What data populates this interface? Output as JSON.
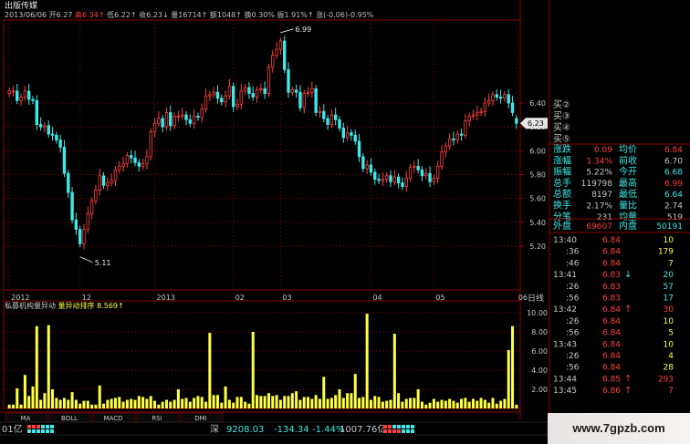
{
  "header": {
    "stock_name": "出版传媒",
    "date": "2013/06/06",
    "quote_line": [
      {
        "label": "开",
        "value": "6.27",
        "color": "#c0c0c0"
      },
      {
        "label": "高",
        "value": "6.34",
        "color": "#ff4040",
        "arrow": "↑"
      },
      {
        "label": "低",
        "value": "6.22",
        "color": "#c0c0c0",
        "arrow": "↑"
      },
      {
        "label": "收",
        "value": "6.23",
        "color": "#c0c0c0",
        "arrow": "↓"
      },
      {
        "label": "量",
        "value": "16714",
        "color": "#c0c0c0",
        "arrow": "↑"
      },
      {
        "label": "额",
        "value": "1048",
        "color": "#c0c0c0",
        "arrow": "↑"
      },
      {
        "label": "换",
        "value": "0.30%",
        "color": "#c0c0c0"
      },
      {
        "label": "振",
        "value": "1.91%",
        "color": "#c0c0c0",
        "arrow": "↑"
      },
      {
        "label": "涨",
        "value": "(-0.06)-0.95%",
        "color": "#c0c0c0"
      }
    ]
  },
  "volume_header": {
    "title": "私募机构量异动",
    "sort_label": "量异动排序",
    "sort_value": "8.569",
    "arrow": "↑"
  },
  "colors": {
    "up": "#ff4040",
    "down": "#40e8e8",
    "volume": "#ffff40",
    "grid": "#8b0000",
    "axis_text": "#c8c8c8",
    "hline": "#e8e8e8"
  },
  "chart_data": [
    {
      "type": "candlestick",
      "title": "",
      "y_ticks": [
        5.2,
        5.4,
        5.6,
        5.8,
        6.0,
        6.2,
        6.4
      ],
      "ylim": [
        5.11,
        6.99
      ],
      "period_label": "日线",
      "last_price_label": "6.23",
      "x_ticks": [
        {
          "label": "2012",
          "at_bar": 0
        },
        {
          "label": "12",
          "at_bar": 18
        },
        {
          "label": "2013",
          "at_bar": 37
        },
        {
          "label": "02",
          "at_bar": 57
        },
        {
          "label": "03",
          "at_bar": 69
        },
        {
          "label": "04",
          "at_bar": 92
        },
        {
          "label": "05",
          "at_bar": 108
        },
        {
          "label": "06",
          "at_bar": 129
        }
      ],
      "annotations": [
        {
          "text": "5.11",
          "at_bar": 18,
          "value": 5.11,
          "kind": "low"
        },
        {
          "text": "6.99",
          "at_bar": 69,
          "value": 6.99,
          "kind": "high"
        }
      ],
      "ohlc_closes": [
        6.5,
        6.5,
        6.42,
        6.45,
        6.5,
        6.43,
        6.42,
        6.22,
        6.2,
        6.21,
        6.14,
        6.13,
        6.09,
        6.03,
        5.81,
        5.65,
        5.42,
        5.34,
        5.22,
        5.34,
        5.47,
        5.58,
        5.67,
        5.79,
        5.71,
        5.73,
        5.75,
        5.84,
        5.87,
        5.89,
        5.96,
        5.94,
        5.9,
        5.87,
        5.89,
        5.95,
        6.16,
        6.23,
        6.27,
        6.2,
        6.32,
        6.21,
        6.29,
        6.29,
        6.3,
        6.26,
        6.23,
        6.29,
        6.28,
        6.35,
        6.46,
        6.47,
        6.49,
        6.44,
        6.41,
        6.46,
        6.54,
        6.37,
        6.39,
        6.5,
        6.53,
        6.48,
        6.45,
        6.51,
        6.52,
        6.48,
        6.7,
        6.8,
        6.85,
        6.92,
        6.68,
        6.49,
        6.51,
        6.49,
        6.36,
        6.48,
        6.49,
        6.52,
        6.32,
        6.33,
        6.27,
        6.22,
        6.3,
        6.26,
        6.19,
        6.11,
        6.15,
        6.13,
        6.08,
        5.95,
        5.85,
        5.88,
        5.82,
        5.76,
        5.75,
        5.76,
        5.79,
        5.74,
        5.78,
        5.73,
        5.7,
        5.77,
        5.86,
        5.87,
        5.84,
        5.79,
        5.81,
        5.74,
        5.77,
        5.87,
        5.99,
        6.04,
        6.1,
        6.09,
        6.14,
        6.13,
        6.25,
        6.29,
        6.3,
        6.32,
        6.33,
        6.4,
        6.42,
        6.47,
        6.45,
        6.44,
        6.47,
        6.4,
        6.32,
        6.23
      ],
      "ohlc_opens": [
        6.48,
        6.5,
        6.5,
        6.42,
        6.45,
        6.5,
        6.43,
        6.42,
        6.22,
        6.2,
        6.21,
        6.14,
        6.13,
        6.09,
        6.03,
        5.81,
        5.65,
        5.42,
        5.34,
        5.22,
        5.34,
        5.47,
        5.58,
        5.67,
        5.79,
        5.71,
        5.73,
        5.75,
        5.84,
        5.87,
        5.89,
        5.96,
        5.94,
        5.9,
        5.87,
        5.89,
        5.95,
        6.16,
        6.23,
        6.27,
        6.2,
        6.32,
        6.21,
        6.29,
        6.29,
        6.3,
        6.26,
        6.23,
        6.29,
        6.28,
        6.35,
        6.46,
        6.47,
        6.49,
        6.44,
        6.41,
        6.46,
        6.54,
        6.37,
        6.39,
        6.5,
        6.53,
        6.48,
        6.45,
        6.51,
        6.52,
        6.48,
        6.7,
        6.8,
        6.85,
        6.92,
        6.68,
        6.49,
        6.51,
        6.49,
        6.36,
        6.48,
        6.49,
        6.52,
        6.32,
        6.33,
        6.27,
        6.22,
        6.3,
        6.26,
        6.19,
        6.11,
        6.15,
        6.13,
        6.08,
        5.95,
        5.85,
        5.88,
        5.82,
        5.76,
        5.75,
        5.76,
        5.79,
        5.74,
        5.78,
        5.73,
        5.7,
        5.77,
        5.86,
        5.87,
        5.84,
        5.79,
        5.81,
        5.74,
        5.77,
        5.87,
        5.99,
        6.04,
        6.1,
        6.09,
        6.14,
        6.13,
        6.25,
        6.29,
        6.3,
        6.32,
        6.33,
        6.4,
        6.42,
        6.47,
        6.45,
        6.44,
        6.47,
        6.4,
        6.27
      ]
    },
    {
      "type": "bar",
      "title": "",
      "y_ticks": [
        2.0,
        4.0,
        6.0,
        8.0,
        10.0
      ],
      "ylim": [
        0,
        10.5
      ],
      "values": [
        0.4,
        0.4,
        2.1,
        0.4,
        3.5,
        1.3,
        2.3,
        8.6,
        0.9,
        1.6,
        8.7,
        2.0,
        1.1,
        0.9,
        1.1,
        0.9,
        1.7,
        0.9,
        0.5,
        0.8,
        0.8,
        0.4,
        0.4,
        2.4,
        0.5,
        0.9,
        1.0,
        1.1,
        1.2,
        0.7,
        0.9,
        1.0,
        0.9,
        1.3,
        1.2,
        1.0,
        1.3,
        0.8,
        0.4,
        0.7,
        0.9,
        0.7,
        0.9,
        2.0,
        1.0,
        1.1,
        0.7,
        1.1,
        1.3,
        1.2,
        0.7,
        7.9,
        1.4,
        1.4,
        0.6,
        2.3,
        0.9,
        0.6,
        1.2,
        1.2,
        0.7,
        0.5,
        8.0,
        1.4,
        1.3,
        1.3,
        1.6,
        1.3,
        1.4,
        0.9,
        1.3,
        1.3,
        1.6,
        1.8,
        0.9,
        1.2,
        1.2,
        1.0,
        1.4,
        1.0,
        3.3,
        1.0,
        1.1,
        1.4,
        2.0,
        1.1,
        1.6,
        1.6,
        3.6,
        1.1,
        1.2,
        9.9,
        0.9,
        1.3,
        1.2,
        0.7,
        0.8,
        0.9,
        7.8,
        1.6,
        0.7,
        1.0,
        1.1,
        1.1,
        2.0,
        0.7,
        0.4,
        0.6,
        1.0,
        0.7,
        0.9,
        0.8,
        1.0,
        0.8,
        0.6,
        1.0,
        1.1,
        0.7,
        1.0,
        0.8,
        1.1,
        0.9,
        0.6,
        1.1,
        0.5,
        0.8,
        1.0,
        6.1,
        8.6,
        0.4
      ]
    }
  ],
  "bottom_tabs": [
    "MA",
    "BOLL",
    "MACD",
    "RSI",
    "DMI"
  ],
  "status_bar": {
    "left_fragment": "01亿",
    "index_name": "深",
    "index_value": "9208.03",
    "index_change": "-134.34",
    "index_pct": "-1.44%",
    "turnover": "1007.76亿"
  },
  "order_book_buys": [
    "买②",
    "买③",
    "买④",
    "买⑤"
  ],
  "quote_table": [
    [
      {
        "label": "涨跌",
        "value": "0.09",
        "color": "#ff4040"
      },
      {
        "label": "均价",
        "value": "6.84",
        "color": "#ff4040"
      }
    ],
    [
      {
        "label": "涨幅",
        "value": "1.34%",
        "color": "#ff4040"
      },
      {
        "label": "前收",
        "value": "6.70",
        "color": "#c8c8c8"
      }
    ],
    [
      {
        "label": "振幅",
        "value": "5.22%",
        "color": "#c8c8c8"
      },
      {
        "label": "今开",
        "value": "6.68",
        "color": "#40e8e8"
      }
    ],
    [
      {
        "label": "总手",
        "value": "119798",
        "color": "#c8c8c8"
      },
      {
        "label": "最高",
        "value": "6.99",
        "color": "#ff4040"
      }
    ],
    [
      {
        "label": "总额",
        "value": "8197",
        "color": "#c8c8c8"
      },
      {
        "label": "最低",
        "value": "6.64",
        "color": "#40e8e8"
      }
    ],
    [
      {
        "label": "换手",
        "value": "2.17%",
        "color": "#c8c8c8"
      },
      {
        "label": "量比",
        "value": "2.74",
        "color": "#c8c8c8"
      }
    ],
    [
      {
        "label": "分笔",
        "value": "231",
        "color": "#c8c8c8"
      },
      {
        "label": "均量",
        "value": "519",
        "color": "#c8c8c8"
      }
    ]
  ],
  "outer_inner": {
    "outer_label": "外盘",
    "outer_value": "69607",
    "inner_label": "内盘",
    "inner_value": "50191"
  },
  "ticks": [
    {
      "time": "13:40",
      "price": "6.84",
      "vol": "10",
      "arrow": "",
      "vcolor": "#ffff40"
    },
    {
      "time": ":36",
      "price": "6.84",
      "vol": "179",
      "arrow": "",
      "vcolor": "#ffff40"
    },
    {
      "time": ":46",
      "price": "6.84",
      "vol": "7",
      "arrow": "",
      "vcolor": "#ffff40"
    },
    {
      "time": "13:41",
      "price": "6.83",
      "vol": "20",
      "arrow": "↓",
      "vcolor": "#40e8e8"
    },
    {
      "time": ":26",
      "price": "6.83",
      "vol": "57",
      "arrow": "",
      "vcolor": "#40e8e8"
    },
    {
      "time": ":56",
      "price": "6.83",
      "vol": "17",
      "arrow": "",
      "vcolor": "#40e8e8"
    },
    {
      "time": "13:42",
      "price": "6.84",
      "vol": "30",
      "arrow": "↑",
      "vcolor": "#ff4040"
    },
    {
      "time": ":26",
      "price": "6.84",
      "vol": "10",
      "arrow": "",
      "vcolor": "#ffff40"
    },
    {
      "time": ":56",
      "price": "6.84",
      "vol": "5",
      "arrow": "",
      "vcolor": "#ffff40"
    },
    {
      "time": "13:43",
      "price": "6.84",
      "vol": "10",
      "arrow": "",
      "vcolor": "#ffff40"
    },
    {
      "time": ":26",
      "price": "6.84",
      "vol": "4",
      "arrow": "",
      "vcolor": "#ffff40"
    },
    {
      "time": ":56",
      "price": "6.84",
      "vol": "28",
      "arrow": "",
      "vcolor": "#ffff40"
    },
    {
      "time": "13:44",
      "price": "6.85",
      "vol": "293",
      "arrow": "↑",
      "vcolor": "#ff4040"
    },
    {
      "time": "13:45",
      "price": "6.86",
      "vol": "7",
      "arrow": "↑",
      "vcolor": "#ff4040"
    }
  ],
  "watermark": "www.7gpzb.com"
}
